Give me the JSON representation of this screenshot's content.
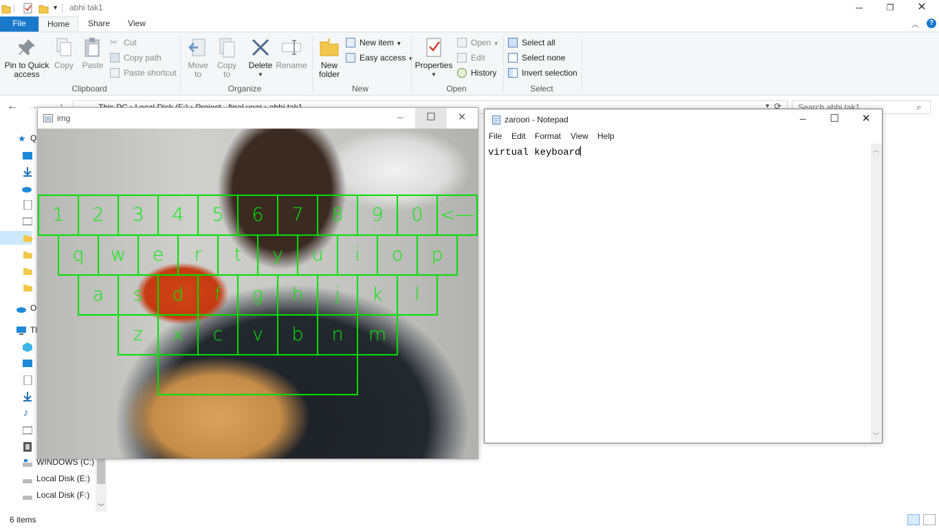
{
  "explorer": {
    "title": "abhi tak1",
    "tabs": [
      "File",
      "Home",
      "Share",
      "View"
    ],
    "ribbon": {
      "clipboard": {
        "label": "Clipboard",
        "pin": "Pin to Quick\naccess",
        "copy": "Copy",
        "paste": "Paste",
        "cut": "Cut",
        "copy_path": "Copy path",
        "paste_shortcut": "Paste shortcut"
      },
      "organize": {
        "label": "Organize",
        "move_to": "Move\nto",
        "copy_to": "Copy\nto",
        "delete": "Delete",
        "rename": "Rename"
      },
      "new": {
        "label": "New",
        "new_folder": "New\nfolder",
        "new_item": "New item",
        "easy_access": "Easy access"
      },
      "open": {
        "label": "Open",
        "properties": "Properties",
        "open": "Open",
        "edit": "Edit",
        "history": "History"
      },
      "select": {
        "label": "Select",
        "select_all": "Select all",
        "select_none": "Select none",
        "invert_selection": "Invert selection"
      }
    },
    "address": {
      "crumbs": [
        "This PC",
        "Local Disk (F:)",
        "Project - final year",
        "abhi tak1"
      ],
      "search_placeholder": "Search abhi tak1"
    },
    "nav": {
      "quick_access_label": "Q",
      "onedrive_label": "O",
      "thispc_label": "Tl",
      "drives": [
        "WINDOWS (C:)",
        "Local Disk (E:)",
        "Local Disk (F:)"
      ]
    },
    "status": "6 items"
  },
  "img_window": {
    "title": "img",
    "keyboard_rows": [
      [
        "1",
        "2",
        "3",
        "4",
        "5",
        "6",
        "7",
        "8",
        "9",
        "0",
        "<—"
      ],
      [
        "q",
        "w",
        "e",
        "r",
        "t",
        "y",
        "u",
        "i",
        "o",
        "p"
      ],
      [
        "a",
        "s",
        "d",
        "f",
        "g",
        "h",
        "j",
        "k",
        "l"
      ],
      [
        "z",
        "x",
        "c",
        "v",
        "b",
        "n",
        "m"
      ]
    ]
  },
  "notepad": {
    "title": "zaroori - Notepad",
    "menu": [
      "File",
      "Edit",
      "Format",
      "View",
      "Help"
    ],
    "text": "virtual keyboard"
  },
  "colors": {
    "accent": "#1979ca",
    "key_outline": "#00e000"
  }
}
